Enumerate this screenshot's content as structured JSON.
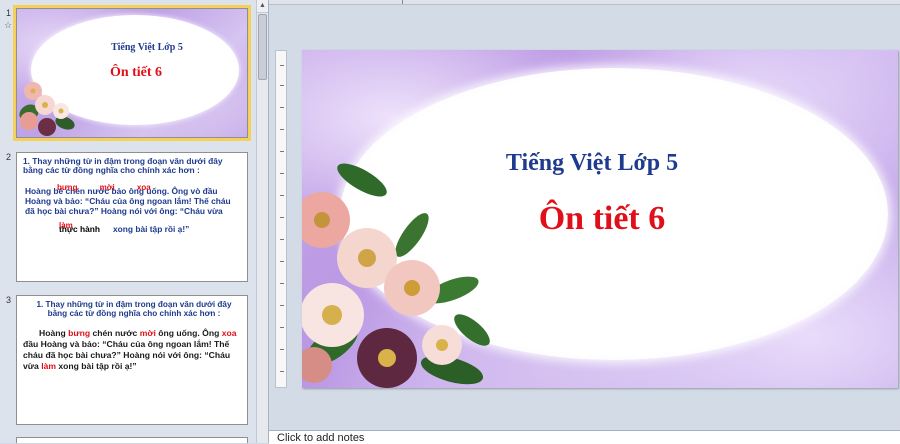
{
  "thumbnails": [
    {
      "number": "1",
      "title": "Tiếng Việt Lớp 5",
      "subtitle": "Ôn tiết 6"
    },
    {
      "number": "2",
      "heading": "1. Thay những từ in đậm trong đoạn văn dưới đây bằng các từ đồng nghĩa cho chính xác hơn :",
      "line1": "Hoàng bê chén nước bảo ông uống. Ông vò đầu",
      "line1_overlay": "bưng  mời  xoa",
      "line2": "Hoàng và bảo: “Cháu của ông ngoan lắm! Thế cháu",
      "line3": "đã học bài chưa?” Hoàng nói với ông: “Cháu vừa",
      "line4_pre": "thực hành",
      "line4_overlay": "làm",
      "line4_post": "xong bài tập rồi ạ!”"
    },
    {
      "number": "3",
      "heading": "1. Thay những từ in đậm trong đoạn văn dưới đây bằng các từ đồng nghĩa cho chính xác hơn :",
      "p1": "Hoàng",
      "w1": "bưng",
      "p2": "chén nước",
      "w2": "mời",
      "p3": "ông uống. Ông",
      "w3": "xoa",
      "line2": "đầu Hoàng và bảo: “Cháu của ông ngoan lắm! Thế",
      "line3": "cháu đã học bài chưa?” Hoàng nói với ông: “Cháu",
      "p4": "vừa",
      "w4": "làm",
      "p5": "xong bài tập rồi ạ!”"
    }
  ],
  "slide": {
    "title": "Tiếng Việt Lớp 5",
    "subtitle": "Ôn tiết 6"
  },
  "notes": {
    "placeholder": "Click to add notes"
  },
  "colors": {
    "title_blue": "#1f3b8e",
    "subtitle_red": "#e0101a",
    "selection": "#f6d15a"
  }
}
